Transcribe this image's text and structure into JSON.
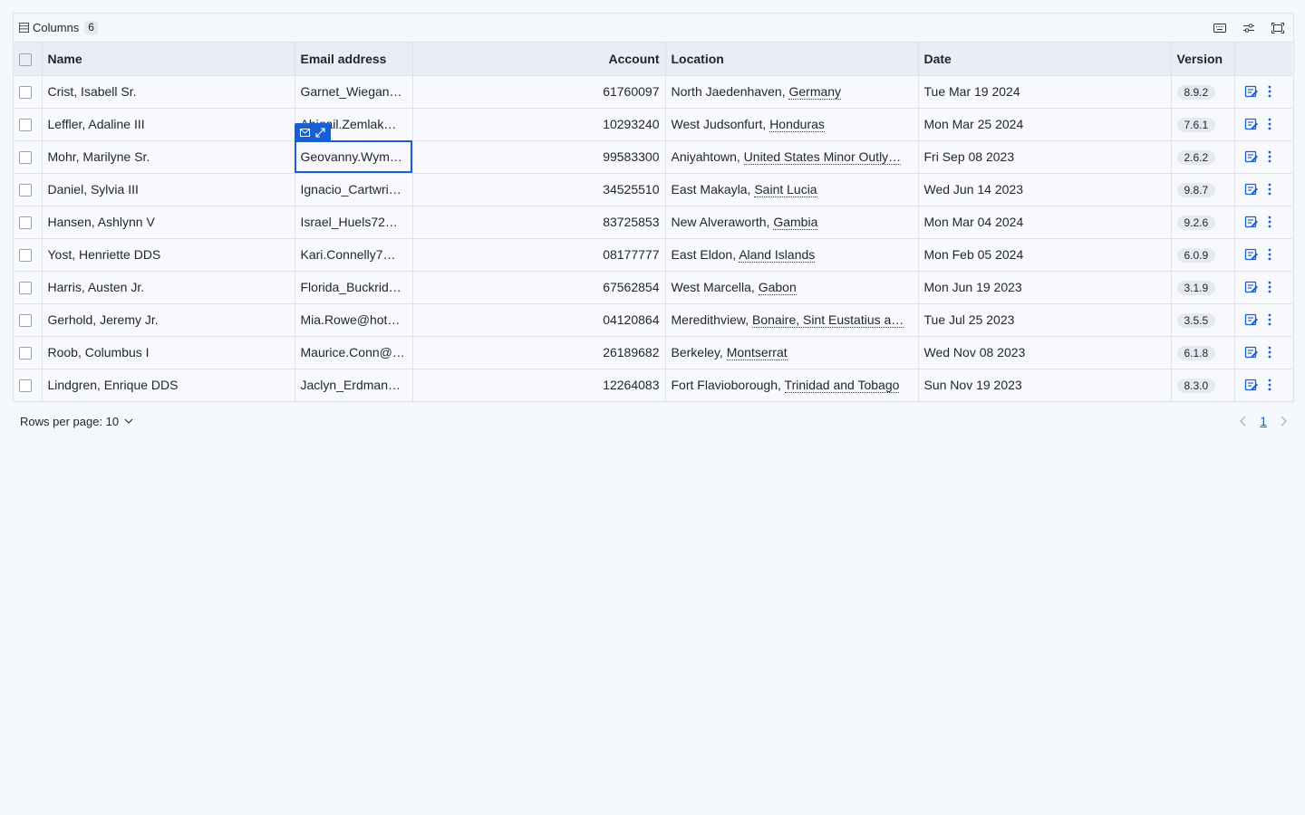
{
  "toolbar": {
    "columns_label": "Columns",
    "columns_count": "6"
  },
  "headers": {
    "name": "Name",
    "email": "Email address",
    "account": "Account",
    "location": "Location",
    "date": "Date",
    "version": "Version"
  },
  "rows": [
    {
      "name": "Crist, Isabell Sr.",
      "email": "Garnet_Wiegan…",
      "account": "61760097",
      "city": "North Jaedenhaven, ",
      "country": "Germany",
      "date": "Tue Mar 19 2024",
      "version": "8.9.2"
    },
    {
      "name": "Leffler, Adaline III",
      "email": "Abigail.Zemlak…",
      "account": "10293240",
      "city": "West Judsonfurt, ",
      "country": "Honduras",
      "date": "Mon Mar 25 2024",
      "version": "7.6.1"
    },
    {
      "name": "Mohr, Marilyne Sr.",
      "email": "Geovanny.Wym…",
      "account": "99583300",
      "city": "Aniyahtown, ",
      "country": "United States Minor Outly…",
      "date": "Fri Sep 08 2023",
      "version": "2.6.2"
    },
    {
      "name": "Daniel, Sylvia III",
      "email": "Ignacio_Cartwri…",
      "account": "34525510",
      "city": "East Makayla, ",
      "country": "Saint Lucia",
      "date": "Wed Jun 14 2023",
      "version": "9.8.7"
    },
    {
      "name": "Hansen, Ashlynn V",
      "email": "Israel_Huels72…",
      "account": "83725853",
      "city": "New Alveraworth, ",
      "country": "Gambia",
      "date": "Mon Mar 04 2024",
      "version": "9.2.6"
    },
    {
      "name": "Yost, Henriette DDS",
      "email": "Kari.Connelly7…",
      "account": "08177777",
      "city": "East Eldon, ",
      "country": "Aland Islands",
      "date": "Mon Feb 05 2024",
      "version": "6.0.9"
    },
    {
      "name": "Harris, Austen Jr.",
      "email": "Florida_Buckrid…",
      "account": "67562854",
      "city": "West Marcella, ",
      "country": "Gabon",
      "date": "Mon Jun 19 2023",
      "version": "3.1.9"
    },
    {
      "name": "Gerhold, Jeremy Jr.",
      "email": "Mia.Rowe@hot…",
      "account": "04120864",
      "city": "Meredithview, ",
      "country": "Bonaire, Sint Eustatius a…",
      "date": "Tue Jul 25 2023",
      "version": "3.5.5"
    },
    {
      "name": "Roob, Columbus I",
      "email": "Maurice.Conn@…",
      "account": "26189682",
      "city": "Berkeley, ",
      "country": "Montserrat",
      "date": "Wed Nov 08 2023",
      "version": "6.1.8"
    },
    {
      "name": "Lindgren, Enrique DDS",
      "email": "Jaclyn_Erdman…",
      "account": "12264083",
      "city": "Fort Flavioborough, ",
      "country": "Trinidad and Tobago",
      "date": "Sun Nov 19 2023",
      "version": "8.3.0"
    }
  ],
  "focused_row_index": 2,
  "footer": {
    "rows_per_page_label": "Rows per page: 10",
    "current_page": "1"
  },
  "colors": {
    "accent": "#1a5fd1",
    "header_bg": "#e9eef6",
    "page_bg": "#f5f8fb"
  }
}
